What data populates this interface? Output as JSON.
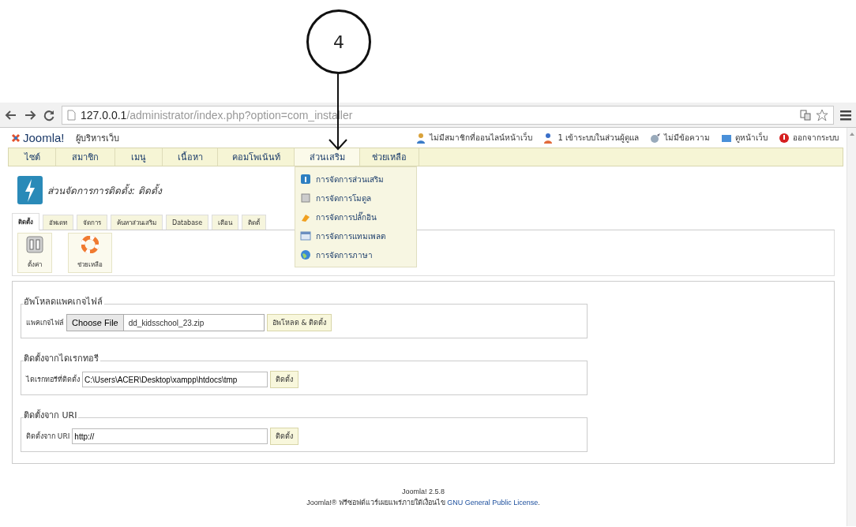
{
  "annotation": {
    "label": "4"
  },
  "browser": {
    "url_host": "127.0.0.1",
    "url_path": "/administrator/index.php?option=com_installer"
  },
  "header": {
    "logo": "Joomla!",
    "site_title": "ผู้บริหารเว็บ",
    "status": [
      {
        "kind": "visitors",
        "text": "ไม่มีสมาชิกที่ออนไลน์หน้าเว็บ"
      },
      {
        "kind": "admins",
        "text": "1 เข้าระบบในส่วนผู้ดูแล"
      },
      {
        "kind": "messages",
        "text": "ไม่มีข้อความ"
      },
      {
        "kind": "site",
        "text": "ดูหน้าเว็บ"
      },
      {
        "kind": "logout",
        "text": "ออกจากระบบ"
      }
    ]
  },
  "menu": [
    {
      "label": "ไซต์",
      "selected": false
    },
    {
      "label": "สมาชิก",
      "selected": false
    },
    {
      "label": "เมนู",
      "selected": false
    },
    {
      "label": "เนื้อหา",
      "selected": false
    },
    {
      "label": "คอมโพเน้นท์",
      "selected": false
    },
    {
      "label": "ส่วนเสริม",
      "selected": true
    },
    {
      "label": "ช่วยเหลือ",
      "selected": false
    }
  ],
  "dropdown": [
    {
      "kind": "extensions",
      "label": "การจัดการส่วนเสริม"
    },
    {
      "kind": "modules",
      "label": "การจัดการโมดูล"
    },
    {
      "kind": "plugins",
      "label": "การจัดการปลั๊กอิน"
    },
    {
      "kind": "templates",
      "label": "การจัดการแทมเพลต"
    },
    {
      "kind": "languages",
      "label": "การจัดการภาษา"
    }
  ],
  "page_title": "ส่วนจัดการการติดตั้ง: ติดตั้ง",
  "tabs": [
    {
      "label": "ติดตั้ง",
      "selected": true
    },
    {
      "label": "อัพเดท",
      "selected": false
    },
    {
      "label": "จัดการ",
      "selected": false
    },
    {
      "label": "ค้นหาส่วนเสริม",
      "selected": false
    },
    {
      "label": "Database",
      "selected": false
    },
    {
      "label": "เตือน",
      "selected": false
    },
    {
      "label": "ติดตั้",
      "selected": false
    }
  ],
  "toolbar": [
    {
      "kind": "options",
      "label": "ตั้งค่า"
    },
    {
      "kind": "help",
      "label": "ช่วยเหลือ"
    }
  ],
  "sections": [
    {
      "kind": "file",
      "legend": "อัพโหลดแพคเกจไฟล์",
      "label": "แพคเกจไฟล์",
      "file_button": "Choose File",
      "value": "dd_kidsschool_23.zip",
      "button": "อัพโหลด & ติดตั้ง"
    },
    {
      "kind": "text",
      "legend": "ติดตั้งจากไดเรกทอรี",
      "label": "ไดเรกทอรีที่ติดตั้ง",
      "value": "C:\\Users\\ACER\\Desktop\\xampp\\htdocs\\tmp",
      "button": "ติดตั้ง"
    },
    {
      "kind": "text",
      "legend": "ติดตั้งจาก URI",
      "label": "ติดตั้งจาก URI",
      "value": "http://",
      "button": "ติดตั้ง"
    }
  ],
  "footer": {
    "version": "Joomla! 2.5.8",
    "license_text": "Joomla!® ฟรีซอฟต์แวร์เผยแพร่ภายใต้เงื่อนไข",
    "license_link": "GNU General Public License",
    "license_end": "."
  }
}
